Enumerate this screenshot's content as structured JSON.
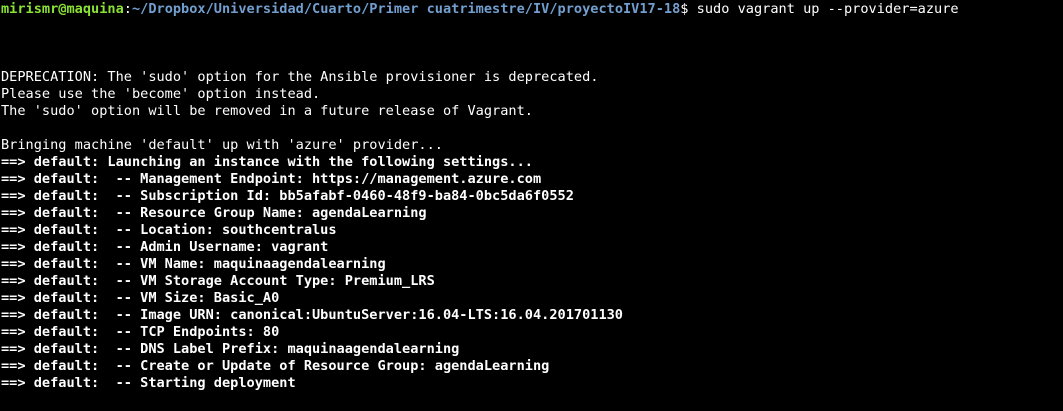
{
  "prompt": {
    "user_host": "mirismr@maquina",
    "separator": ":",
    "path": "~/Dropbox/Universidad/Cuarto/Primer cuatrimestre/IV/proyectoIV17-18",
    "symbol": "$ ",
    "command": "sudo vagrant up --provider=azure"
  },
  "deprecation": [
    "DEPRECATION: The 'sudo' option for the Ansible provisioner is deprecated.",
    "Please use the 'become' option instead.",
    "The 'sudo' option will be removed in a future release of Vagrant."
  ],
  "bringing_up": "Bringing machine 'default' up with 'azure' provider...",
  "output_lines": [
    "==> default: Launching an instance with the following settings...",
    "==> default:  -- Management Endpoint: https://management.azure.com",
    "==> default:  -- Subscription Id: bb5afabf-0460-48f9-ba84-0bc5da6f0552",
    "==> default:  -- Resource Group Name: agendaLearning",
    "==> default:  -- Location: southcentralus",
    "==> default:  -- Admin Username: vagrant",
    "==> default:  -- VM Name: maquinaagendalearning",
    "==> default:  -- VM Storage Account Type: Premium_LRS",
    "==> default:  -- VM Size: Basic_A0",
    "==> default:  -- Image URN: canonical:UbuntuServer:16.04-LTS:16.04.201701130",
    "==> default:  -- TCP Endpoints: 80",
    "==> default:  -- DNS Label Prefix: maquinaagendalearning",
    "==> default:  -- Create or Update of Resource Group: agendaLearning",
    "==> default:  -- Starting deployment"
  ]
}
